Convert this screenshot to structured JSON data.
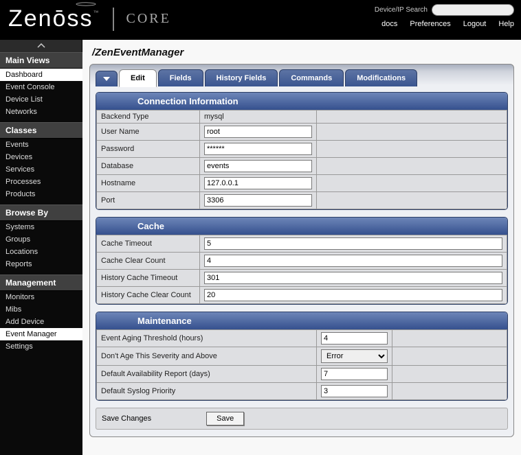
{
  "header": {
    "logo_main": "Zen",
    "logo_accent": "ōss",
    "core": "CORE",
    "search_label": "Device/IP Search",
    "links": {
      "docs": "docs",
      "prefs": "Preferences",
      "logout": "Logout",
      "help": "Help"
    }
  },
  "sidebar": {
    "sections": [
      {
        "title": "Main Views",
        "items": [
          {
            "label": "Dashboard",
            "active": true
          },
          {
            "label": "Event Console"
          },
          {
            "label": "Device List"
          },
          {
            "label": "Networks"
          }
        ]
      },
      {
        "title": "Classes",
        "items": [
          {
            "label": "Events"
          },
          {
            "label": "Devices"
          },
          {
            "label": "Services"
          },
          {
            "label": "Processes"
          },
          {
            "label": "Products"
          }
        ]
      },
      {
        "title": "Browse By",
        "items": [
          {
            "label": "Systems"
          },
          {
            "label": "Groups"
          },
          {
            "label": "Locations"
          },
          {
            "label": "Reports"
          }
        ]
      },
      {
        "title": "Management",
        "items": [
          {
            "label": "Monitors"
          },
          {
            "label": "Mibs"
          },
          {
            "label": "Add Device"
          },
          {
            "label": "Event Manager",
            "active": true
          },
          {
            "label": "Settings"
          }
        ]
      }
    ]
  },
  "main": {
    "breadcrumb": "/ZenEventManager",
    "tabs": {
      "edit": "Edit",
      "fields": "Fields",
      "history": "History Fields",
      "commands": "Commands",
      "mods": "Modifications"
    },
    "connection": {
      "title": "Connection Information",
      "rows": {
        "backend_label": "Backend Type",
        "backend_value": "mysql",
        "user_label": "User Name",
        "user_value": "root",
        "pass_label": "Password",
        "pass_value": "******",
        "db_label": "Database",
        "db_value": "events",
        "host_label": "Hostname",
        "host_value": "127.0.0.1",
        "port_label": "Port",
        "port_value": "3306"
      }
    },
    "cache": {
      "title": "Cache",
      "rows": {
        "timeout_label": "Cache Timeout",
        "timeout_value": "5",
        "clear_label": "Cache Clear Count",
        "clear_value": "4",
        "htimeout_label": "History Cache Timeout",
        "htimeout_value": "301",
        "hclear_label": "History Cache Clear Count",
        "hclear_value": "20"
      }
    },
    "maint": {
      "title": "Maintenance",
      "rows": {
        "aging_label": "Event Aging Threshold (hours)",
        "aging_value": "4",
        "sev_label": "Don't Age This Severity and Above",
        "sev_value": "Error",
        "avail_label": "Default Availability Report (days)",
        "avail_value": "7",
        "syslog_label": "Default Syslog Priority",
        "syslog_value": "3"
      }
    },
    "save": {
      "label": "Save Changes",
      "button": "Save"
    }
  }
}
